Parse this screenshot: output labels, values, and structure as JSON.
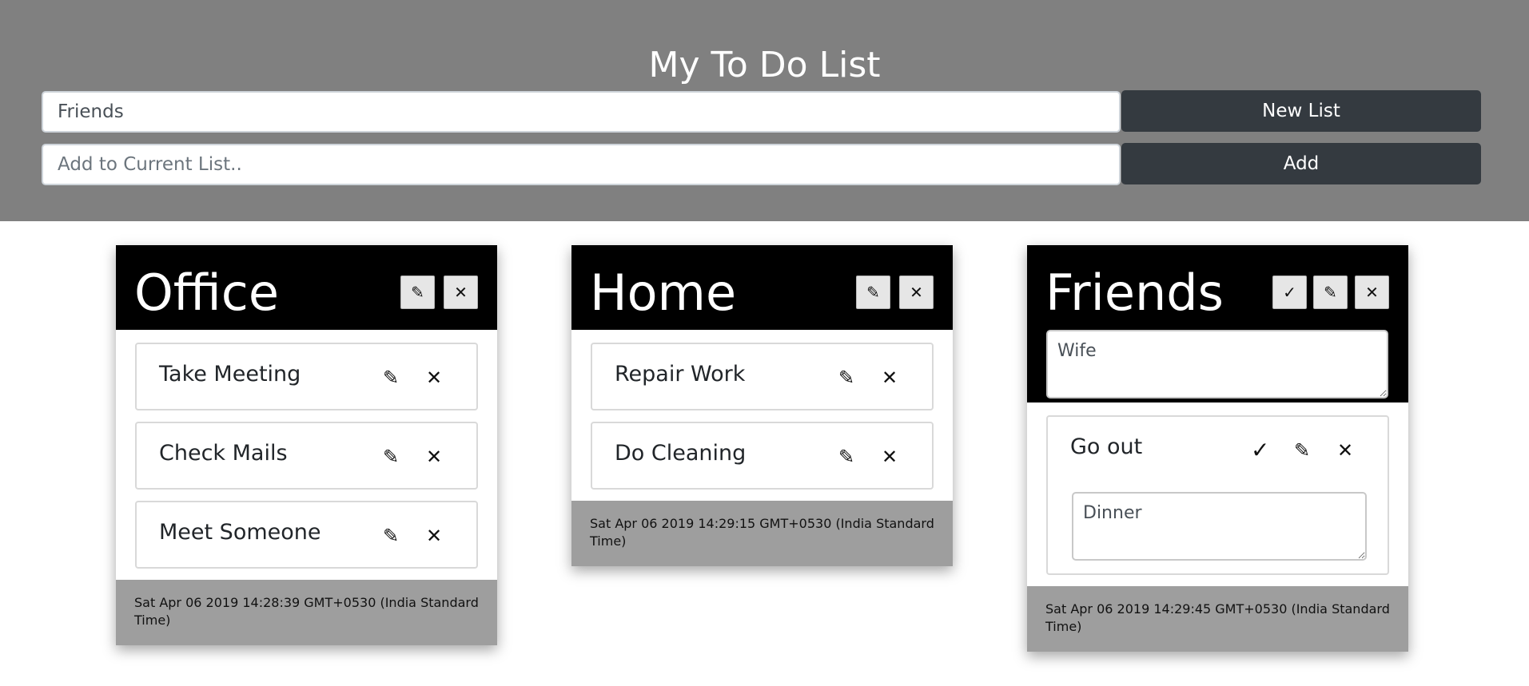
{
  "header": {
    "title": "My To Do List",
    "list_name_value": "Friends",
    "new_list_label": "New List",
    "item_placeholder": "Add to Current List..",
    "add_label": "Add"
  },
  "icons": {
    "edit": "pencil-icon",
    "delete": "close-icon",
    "confirm": "checkmark-icon"
  },
  "lists": [
    {
      "title": "Office",
      "items": [
        "Take Meeting",
        "Check Mails",
        "Meet Someone"
      ],
      "timestamp": "Sat Apr 06 2019 14:28:39 GMT+0530 (India Standard Time)"
    },
    {
      "title": "Home",
      "items": [
        "Repair Work",
        "Do Cleaning"
      ],
      "timestamp": "Sat Apr 06 2019 14:29:15 GMT+0530 (India Standard Time)"
    },
    {
      "title": "Friends",
      "title_edit_value": "Wife",
      "items": [
        "Go out"
      ],
      "item_edit_value": "Dinner",
      "timestamp": "Sat Apr 06 2019 14:29:45 GMT+0530 (India Standard Time)"
    }
  ],
  "colors": {
    "header_bg": "#808080",
    "button_bg": "#343a40",
    "card_head_bg": "#000000",
    "card_foot_bg": "#9e9e9e"
  }
}
